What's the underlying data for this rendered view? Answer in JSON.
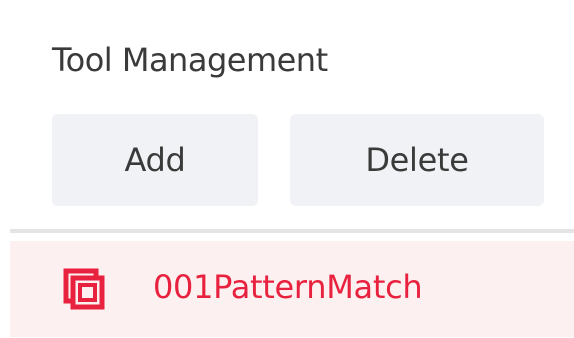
{
  "panel": {
    "title": "Tool Management"
  },
  "toolbar": {
    "add_label": "Add",
    "delete_label": "Delete"
  },
  "tools": {
    "items": [
      {
        "label": "001PatternMatch",
        "icon": "pattern-match-icon",
        "selected": true
      }
    ]
  },
  "colors": {
    "selected_text": "#e8213f",
    "selected_background": "#fdf0f0",
    "button_background": "#f0f2f5"
  }
}
